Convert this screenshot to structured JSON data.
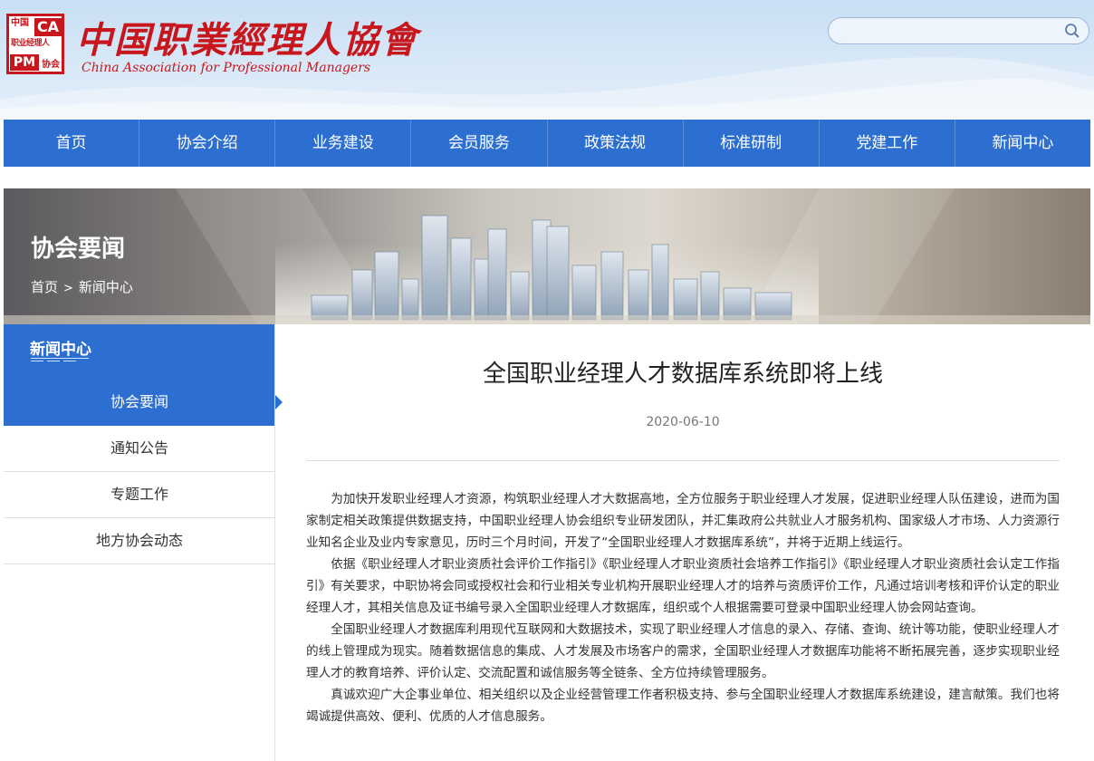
{
  "header": {
    "logo_q1": "中国",
    "logo_q2": "CA",
    "logo_q3": "职业经理人",
    "logo_q4": "PM",
    "logo_q5": "协会",
    "title": "中国职業經理人協會",
    "subtitle": "China Association for Professional Managers",
    "search_placeholder": "",
    "brand_red": "#c8161d"
  },
  "nav": {
    "items": [
      "首页",
      "协会介绍",
      "业务建设",
      "会员服务",
      "政策法规",
      "标准研制",
      "党建工作",
      "新闻中心"
    ],
    "bg_color": "#2d6fd0"
  },
  "banner": {
    "title": "协会要闻",
    "breadcrumb_home": "首页",
    "breadcrumb_sep": ">",
    "breadcrumb_current": "新闻中心"
  },
  "sidebar": {
    "heading": "新闻中心",
    "items": [
      "协会要闻",
      "通知公告",
      "专题工作",
      "地方协会动态"
    ],
    "active_index": 0
  },
  "article": {
    "title": "全国职业经理人才数据库系统即将上线",
    "date": "2020-06-10",
    "paragraphs": [
      "为加快开发职业经理人才资源，构筑职业经理人才大数据高地，全方位服务于职业经理人才发展，促进职业经理人队伍建设，进而为国家制定相关政策提供数据支持，中国职业经理人协会组织专业研发团队，并汇集政府公共就业人才服务机构、国家级人才市场、人力资源行业知名企业及业内专家意见，历时三个月时间，开发了“全国职业经理人才数据库系统”，并将于近期上线运行。",
      "依据《职业经理人才职业资质社会评价工作指引》《职业经理人才职业资质社会培养工作指引》《职业经理人才职业资质社会认定工作指引》有关要求，中职协将会同或授权社会和行业相关专业机构开展职业经理人才的培养与资质评价工作，凡通过培训考核和评价认定的职业经理人才，其相关信息及证书编号录入全国职业经理人才数据库，组织或个人根据需要可登录中国职业经理人协会网站查询。",
      "全国职业经理人才数据库利用现代互联网和大数据技术，实现了职业经理人才信息的录入、存储、查询、统计等功能，使职业经理人才的线上管理成为现实。随着数据信息的集成、人才发展及市场客户的需求，全国职业经理人才数据库功能将不断拓展完善，逐步实现职业经理人才的教育培养、评价认定、交流配置和诚信服务等全链条、全方位持续管理服务。",
      "真诚欢迎广大企事业单位、相关组织以及企业经营管理工作者积极支持、参与全国职业经理人才数据库系统建设，建言献策。我们也将竭诚提供高效、便利、优质的人才信息服务。"
    ]
  }
}
